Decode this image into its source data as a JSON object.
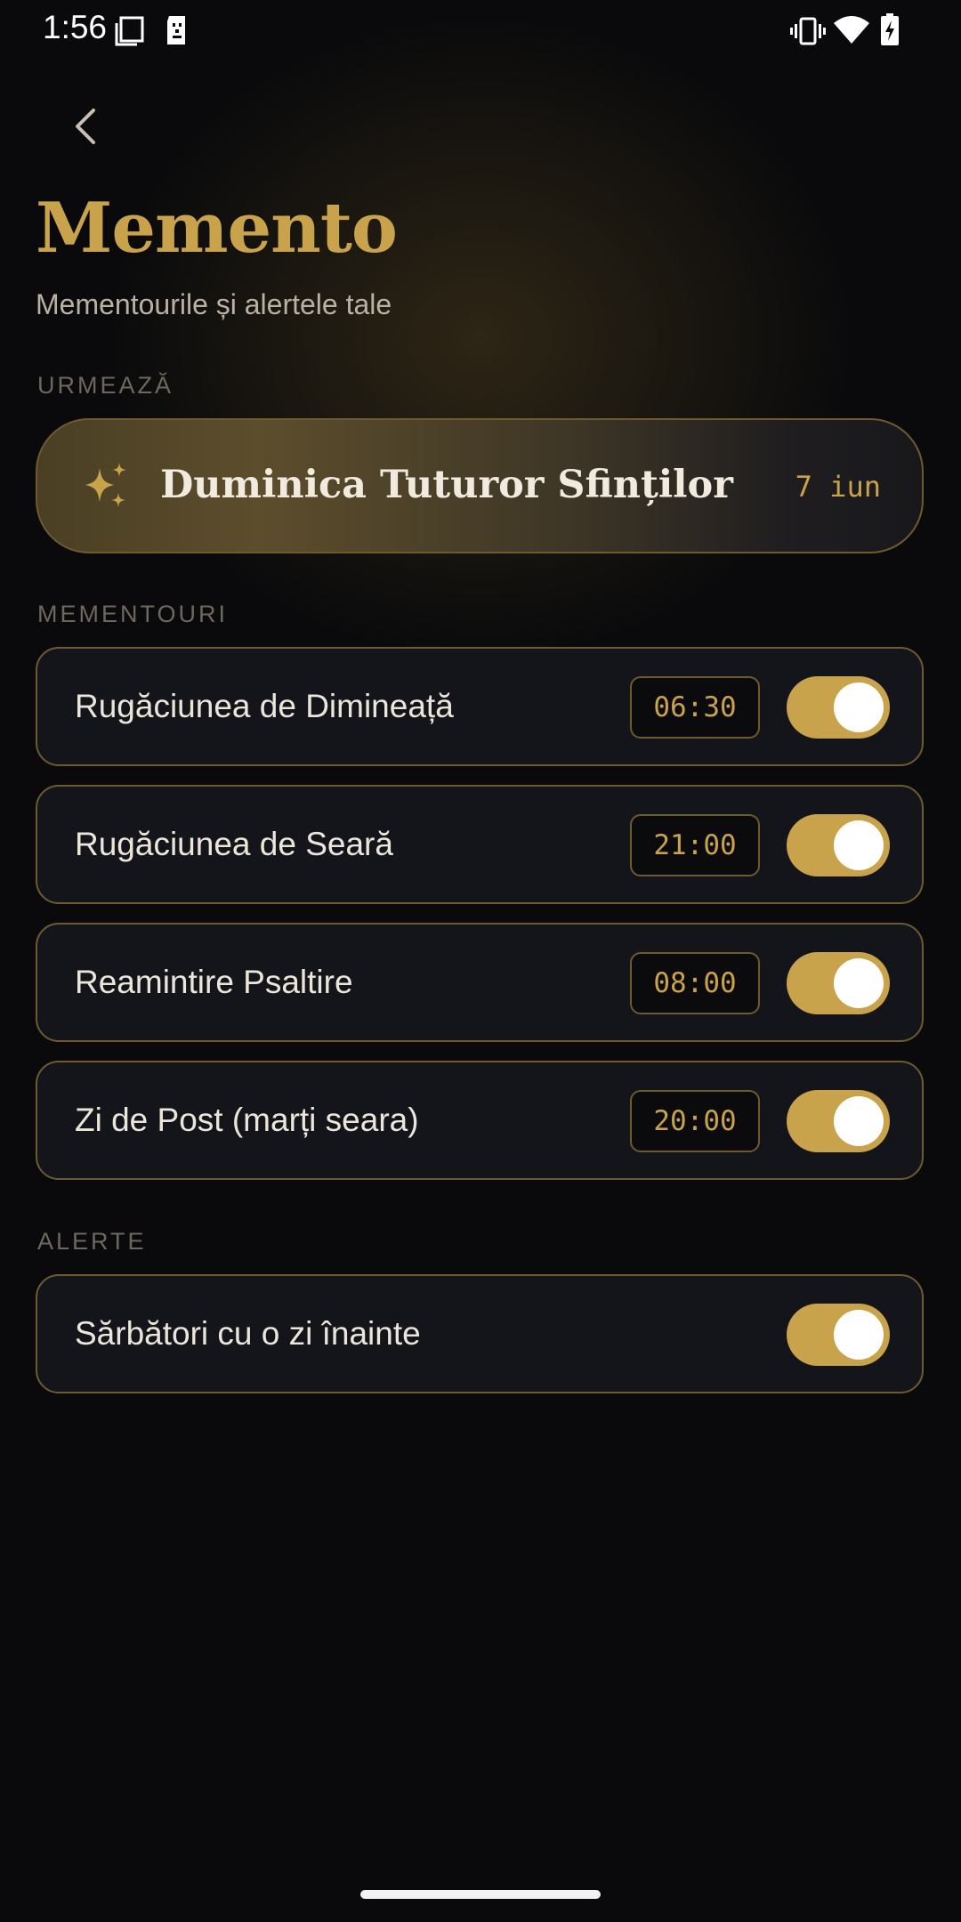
{
  "status_bar": {
    "time": "1:56",
    "icons": [
      "screenshot-icon",
      "sim-card-icon",
      "vibrate-icon",
      "wifi-icon",
      "battery-charging-icon"
    ]
  },
  "header": {
    "back_icon": "chevron-left-icon",
    "title": "Memento",
    "subtitle": "Mementourile și alertele tale"
  },
  "next": {
    "section_label": "URMEAZĂ",
    "icon": "sparkles-icon",
    "title": "Duminica Tuturor Sfinților",
    "date": "7 iun"
  },
  "reminders": {
    "section_label": "MEMENTOURI",
    "items": [
      {
        "label": "Rugăciunea de Dimineață",
        "time": "06:30",
        "enabled": true
      },
      {
        "label": "Rugăciunea de Seară",
        "time": "21:00",
        "enabled": true
      },
      {
        "label": "Reamintire Psaltire",
        "time": "08:00",
        "enabled": true
      },
      {
        "label": "Zi de Post (marți seara)",
        "time": "20:00",
        "enabled": true
      }
    ]
  },
  "alerts": {
    "section_label": "ALERTE",
    "items": [
      {
        "label": "Sărbători cu o zi înainte",
        "enabled": true
      }
    ]
  },
  "colors": {
    "background": "#0a0a0c",
    "accent_gold": "#c9a24c",
    "card_border": "#6d5a2f",
    "card_background": "#14151b",
    "text_primary": "#ece6da",
    "text_muted": "#6e675c"
  }
}
